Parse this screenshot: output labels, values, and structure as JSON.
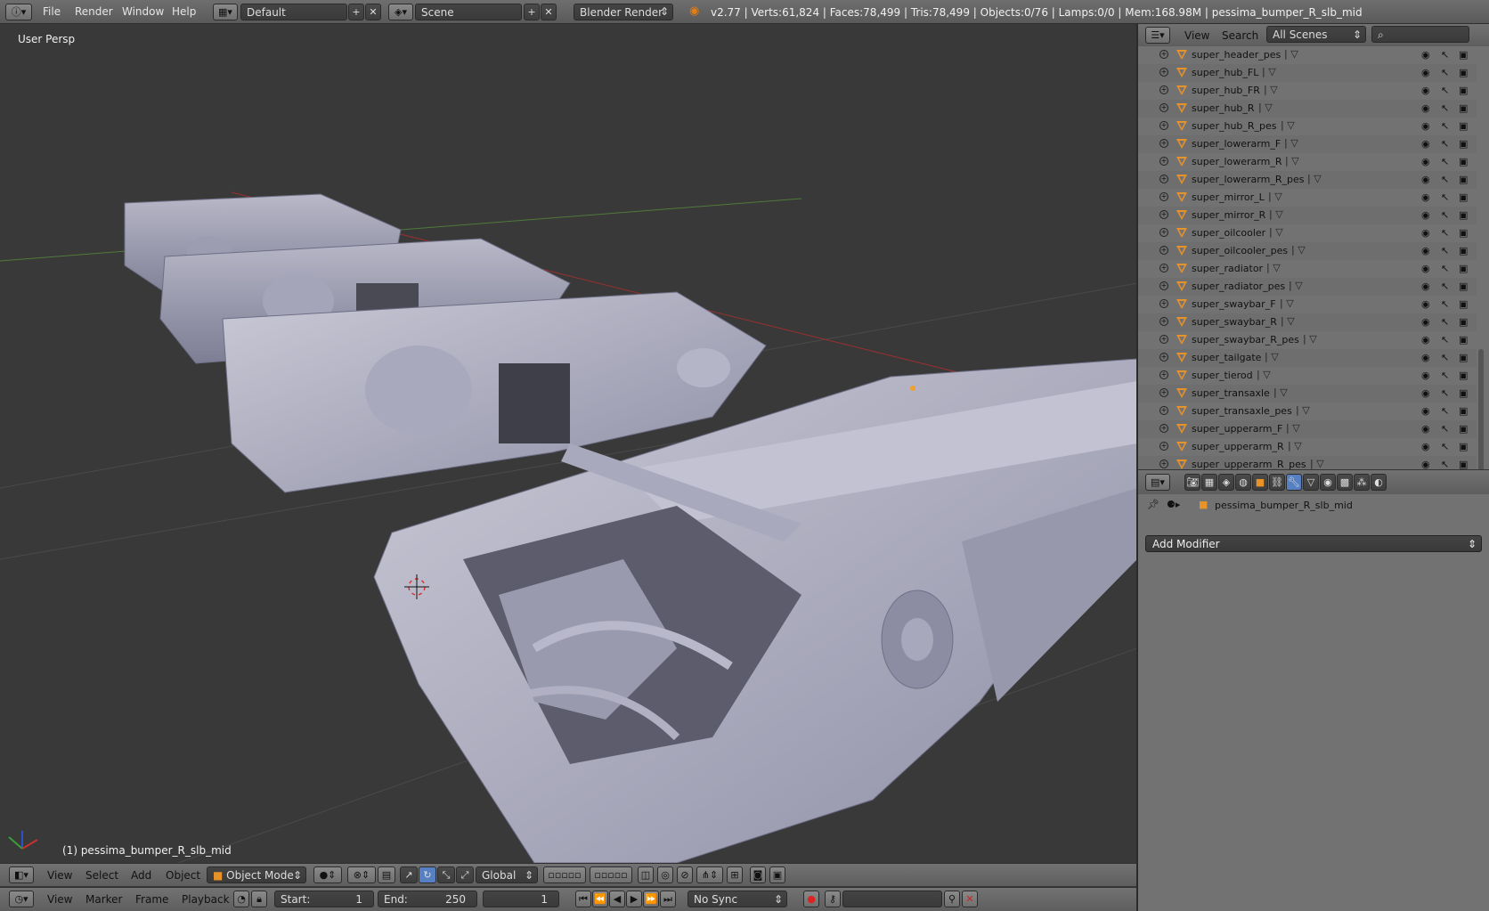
{
  "topbar": {
    "menus": [
      "File",
      "Render",
      "Window",
      "Help"
    ],
    "screen_layout": "Default",
    "scene": "Scene",
    "render_engine": "Blender Render",
    "stats": "v2.77 | Verts:61,824 | Faces:78,499 | Tris:78,499 | Objects:0/76 | Lamps:0/0 | Mem:168.98M | pessima_bumper_R_slb_mid"
  },
  "viewport": {
    "view_label": "User Persp",
    "object_label": "(1) pessima_bumper_R_slb_mid"
  },
  "view3d_header": {
    "menus": [
      "View",
      "Select",
      "Add",
      "Object"
    ],
    "mode": "Object Mode",
    "orientation": "Global"
  },
  "timeline_header": {
    "menus": [
      "View",
      "Marker",
      "Frame",
      "Playback"
    ],
    "start_label": "Start:",
    "start_value": "1",
    "end_label": "End:",
    "end_value": "250",
    "current_frame": "1",
    "sync": "No Sync"
  },
  "outliner": {
    "menus": [
      "View",
      "Search"
    ],
    "filter": "All Scenes",
    "items": [
      "super_header_pes",
      "super_hub_FL",
      "super_hub_FR",
      "super_hub_R",
      "super_hub_R_pes",
      "super_lowerarm_F",
      "super_lowerarm_R",
      "super_lowerarm_R_pes",
      "super_mirror_L",
      "super_mirror_R",
      "super_oilcooler",
      "super_oilcooler_pes",
      "super_radiator",
      "super_radiator_pes",
      "super_swaybar_F",
      "super_swaybar_R",
      "super_swaybar_R_pes",
      "super_tailgate",
      "super_tierod",
      "super_transaxle",
      "super_transaxle_pes",
      "super_upperarm_F",
      "super_upperarm_R",
      "super_upperarm_R_pes"
    ]
  },
  "properties": {
    "object_name": "pessima_bumper_R_slb_mid",
    "add_modifier": "Add Modifier"
  }
}
